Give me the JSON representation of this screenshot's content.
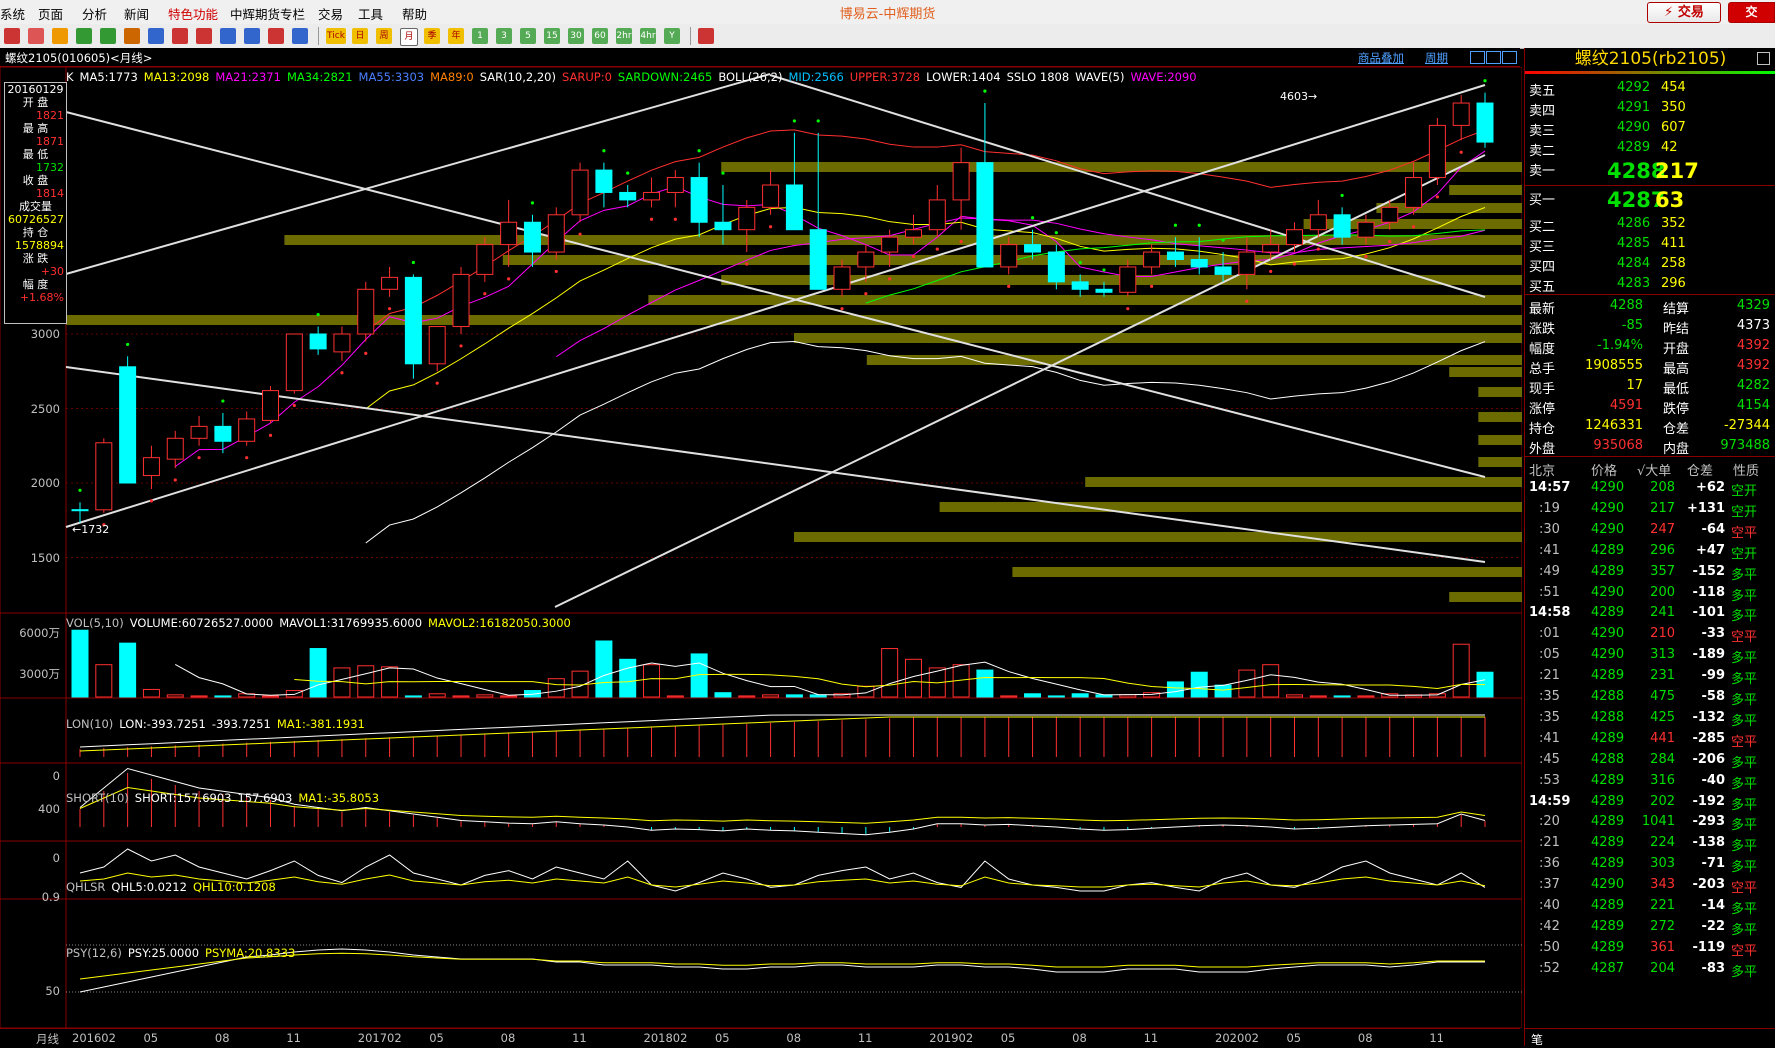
{
  "menu": {
    "items": [
      "系统",
      "页面",
      "分析",
      "新闻",
      "特色功能",
      "中辉期货专栏",
      "交易",
      "工具",
      "帮助"
    ],
    "app_title": "博易云-中辉期货",
    "trade_button": "⚡ 交易"
  },
  "toolbar": {
    "periods": [
      "1",
      "3",
      "5",
      "15",
      "30",
      "60",
      "2hr",
      "4hr",
      "Y"
    ],
    "labels": [
      "Tick",
      "日",
      "周",
      "月",
      "季",
      "年"
    ]
  },
  "chart_header": {
    "title": "螺纹2105(010605)<月线>",
    "overlay_link": "商品叠加",
    "period_link": "周期"
  },
  "indicators": {
    "k_line": [
      {
        "text": "K",
        "color": "#ffffff"
      },
      {
        "text": "MA5:1773",
        "color": "#ffffff"
      },
      {
        "text": "MA13:2098",
        "color": "#ffff00"
      },
      {
        "text": "MA21:2371",
        "color": "#ff00ff"
      },
      {
        "text": "MA34:2821",
        "color": "#00ff00"
      },
      {
        "text": "MA55:3303",
        "color": "#4a7fff"
      },
      {
        "text": "MA89:0",
        "color": "#ff8000"
      },
      {
        "text": "SAR(10,2,20)",
        "color": "#ffffff"
      },
      {
        "text": "SARUP:0",
        "color": "#ff3030"
      },
      {
        "text": "SARDOWN:2465",
        "color": "#00ff00"
      },
      {
        "text": "BOLL(26,2)",
        "color": "#ffffff"
      },
      {
        "text": "MID:2566",
        "color": "#00c0ff"
      },
      {
        "text": "UPPER:3728",
        "color": "#ff3030"
      },
      {
        "text": "LOWER:1404",
        "color": "#ffffff"
      },
      {
        "text": "SSLO 1808",
        "color": "#ffffff"
      },
      {
        "text": "WAVE(5)",
        "color": "#ffffff"
      },
      {
        "text": "WAVE:2090",
        "color": "#ff00ff"
      }
    ],
    "vol": [
      {
        "text": "VOL(5,10)",
        "color": "#c0c0c0"
      },
      {
        "text": "VOLUME:60726527.0000",
        "color": "#ffffff"
      },
      {
        "text": "MAVOL1:31769935.6000",
        "color": "#ffffff"
      },
      {
        "text": "MAVOL2:16182050.3000",
        "color": "#ffff00"
      }
    ],
    "lon": [
      {
        "text": "LON(10)",
        "color": "#c0c0c0"
      },
      {
        "text": "LON:-393.7251",
        "color": "#ffffff"
      },
      {
        "text": "-393.7251",
        "color": "#ffffff"
      },
      {
        "text": "MA1:-381.1931",
        "color": "#ffff00"
      }
    ],
    "short": [
      {
        "text": "SHORT(10)",
        "color": "#c0c0c0"
      },
      {
        "text": "SHORT:157.6903",
        "color": "#ffffff"
      },
      {
        "text": "157.6903",
        "color": "#ffffff"
      },
      {
        "text": "MA1:-35.8053",
        "color": "#ffff00"
      }
    ],
    "qhlsr": [
      {
        "text": "QHLSR",
        "color": "#c0c0c0"
      },
      {
        "text": "QHL5:0.0212",
        "color": "#ffffff"
      },
      {
        "text": "QHL10:0.1208",
        "color": "#ffff00"
      }
    ],
    "psy": [
      {
        "text": "PSY(12,6)",
        "color": "#c0c0c0"
      },
      {
        "text": "PSY:25.0000",
        "color": "#ffffff"
      },
      {
        "text": "PSYMA:20.8333",
        "color": "#ffff00"
      }
    ]
  },
  "axes": {
    "price_ticks": [
      "3000",
      "2500",
      "2000",
      "1500"
    ],
    "vol_ticks": [
      "6000万",
      "3000万"
    ],
    "lon_ticks": [
      "0"
    ],
    "short_ticks": [
      "400",
      "0"
    ],
    "qhlsr_ticks": [
      "0.9"
    ],
    "psy_ticks": [
      "50"
    ],
    "time_label": "月线",
    "time_ticks": [
      "201602",
      "05",
      "08",
      "11",
      "201702",
      "05",
      "08",
      "11",
      "201802",
      "05",
      "08",
      "11",
      "201902",
      "05",
      "08",
      "11",
      "202002",
      "05",
      "08",
      "11"
    ]
  },
  "annotations": {
    "high": "4603",
    "low": "1732"
  },
  "info_box": [
    {
      "label": "20160129",
      "value": ""
    },
    {
      "label": "开 盘",
      "value": "1821"
    },
    {
      "label": "最 高",
      "value": "1871"
    },
    {
      "label": "最 低",
      "value": "1732"
    },
    {
      "label": "收 盘",
      "value": "1814"
    },
    {
      "label": "成交量",
      "value": "60726527"
    },
    {
      "label": "持 仓",
      "value": "1578894"
    },
    {
      "label": "涨 跌",
      "value": "+30"
    },
    {
      "label": "幅 度",
      "value": "+1.68%"
    }
  ],
  "quote": {
    "title": "螺纹2105(rb2105)",
    "asks": [
      {
        "label": "卖五",
        "price": "4292",
        "vol": "454"
      },
      {
        "label": "卖四",
        "price": "4291",
        "vol": "350"
      },
      {
        "label": "卖三",
        "price": "4290",
        "vol": "607"
      },
      {
        "label": "卖二",
        "price": "4289",
        "vol": "42"
      },
      {
        "label": "卖一",
        "price": "4288",
        "vol": "217"
      }
    ],
    "bids": [
      {
        "label": "买一",
        "price": "4287",
        "vol": "63"
      },
      {
        "label": "买二",
        "price": "4286",
        "vol": "352"
      },
      {
        "label": "买三",
        "price": "4285",
        "vol": "411"
      },
      {
        "label": "买四",
        "price": "4284",
        "vol": "258"
      },
      {
        "label": "买五",
        "price": "4283",
        "vol": "296"
      }
    ],
    "stats": [
      {
        "l1": "最新",
        "v1": "4288",
        "c1": "#00e000",
        "l2": "结算",
        "v2": "4329",
        "c2": "#00e000"
      },
      {
        "l1": "涨跌",
        "v1": "-85",
        "c1": "#00e000",
        "l2": "昨结",
        "v2": "4373",
        "c2": "#ffffff"
      },
      {
        "l1": "幅度",
        "v1": "-1.94%",
        "c1": "#00e000",
        "l2": "开盘",
        "v2": "4392",
        "c2": "#ff3030"
      },
      {
        "l1": "总手",
        "v1": "1908555",
        "c1": "#ffff00",
        "l2": "最高",
        "v2": "4392",
        "c2": "#ff3030"
      },
      {
        "l1": "现手",
        "v1": "17",
        "c1": "#ffff00",
        "l2": "最低",
        "v2": "4282",
        "c2": "#00e000"
      },
      {
        "l1": "涨停",
        "v1": "4591",
        "c1": "#ff3030",
        "l2": "跌停",
        "v2": "4154",
        "c2": "#00e000"
      },
      {
        "l1": "持仓",
        "v1": "1246331",
        "c1": "#ffff00",
        "l2": "仓差",
        "v2": "-27344",
        "c2": "#ffff00"
      },
      {
        "l1": "外盘",
        "v1": "935068",
        "c1": "#ff3030",
        "l2": "内盘",
        "v2": "973488",
        "c2": "#00e000"
      }
    ],
    "tick_header": [
      "北京",
      "价格",
      "√大单",
      "仓差",
      "性质"
    ],
    "ticks": [
      {
        "t": "14:57",
        "p": "4290",
        "v": "208",
        "vc": "#00e000",
        "d": "+62",
        "n": "空开",
        "nc": "#00e000"
      },
      {
        "t": ":19",
        "p": "4290",
        "v": "217",
        "vc": "#00e000",
        "d": "+131",
        "n": "空开",
        "nc": "#00e000"
      },
      {
        "t": ":30",
        "p": "4290",
        "v": "247",
        "vc": "#ff3030",
        "d": "-64",
        "n": "空平",
        "nc": "#ff3030"
      },
      {
        "t": ":41",
        "p": "4289",
        "v": "296",
        "vc": "#00e000",
        "d": "+47",
        "n": "空开",
        "nc": "#00e000"
      },
      {
        "t": ":49",
        "p": "4289",
        "v": "357",
        "vc": "#00e000",
        "d": "-152",
        "n": "多平",
        "nc": "#00e000"
      },
      {
        "t": ":51",
        "p": "4290",
        "v": "200",
        "vc": "#00e000",
        "d": "-118",
        "n": "多平",
        "nc": "#00e000"
      },
      {
        "t": "14:58",
        "p": "4289",
        "v": "241",
        "vc": "#00e000",
        "d": "-101",
        "n": "多平",
        "nc": "#00e000"
      },
      {
        "t": ":01",
        "p": "4290",
        "v": "210",
        "vc": "#ff3030",
        "d": "-33",
        "n": "空平",
        "nc": "#ff3030"
      },
      {
        "t": ":05",
        "p": "4290",
        "v": "313",
        "vc": "#00e000",
        "d": "-189",
        "n": "多平",
        "nc": "#00e000"
      },
      {
        "t": ":21",
        "p": "4289",
        "v": "231",
        "vc": "#00e000",
        "d": "-99",
        "n": "多平",
        "nc": "#00e000"
      },
      {
        "t": ":35",
        "p": "4288",
        "v": "475",
        "vc": "#00e000",
        "d": "-58",
        "n": "多平",
        "nc": "#00e000"
      },
      {
        "t": ":35",
        "p": "4288",
        "v": "425",
        "vc": "#00e000",
        "d": "-132",
        "n": "多平",
        "nc": "#00e000"
      },
      {
        "t": ":41",
        "p": "4289",
        "v": "441",
        "vc": "#ff3030",
        "d": "-285",
        "n": "空平",
        "nc": "#ff3030"
      },
      {
        "t": ":45",
        "p": "4288",
        "v": "284",
        "vc": "#00e000",
        "d": "-206",
        "n": "多平",
        "nc": "#00e000"
      },
      {
        "t": ":53",
        "p": "4289",
        "v": "316",
        "vc": "#00e000",
        "d": "-40",
        "n": "多平",
        "nc": "#00e000"
      },
      {
        "t": "14:59",
        "p": "4289",
        "v": "202",
        "vc": "#00e000",
        "d": "-192",
        "n": "多平",
        "nc": "#00e000"
      },
      {
        "t": ":20",
        "p": "4289",
        "v": "1041",
        "vc": "#00e000",
        "d": "-293",
        "n": "多平",
        "nc": "#00e000"
      },
      {
        "t": ":21",
        "p": "4289",
        "v": "224",
        "vc": "#00e000",
        "d": "-138",
        "n": "多平",
        "nc": "#00e000"
      },
      {
        "t": ":36",
        "p": "4289",
        "v": "303",
        "vc": "#00e000",
        "d": "-71",
        "n": "多平",
        "nc": "#00e000"
      },
      {
        "t": ":37",
        "p": "4290",
        "v": "343",
        "vc": "#ff3030",
        "d": "-203",
        "n": "空平",
        "nc": "#ff3030"
      },
      {
        "t": ":40",
        "p": "4289",
        "v": "221",
        "vc": "#00e000",
        "d": "-14",
        "n": "多平",
        "nc": "#00e000"
      },
      {
        "t": ":42",
        "p": "4289",
        "v": "272",
        "vc": "#00e000",
        "d": "-22",
        "n": "多平",
        "nc": "#00e000"
      },
      {
        "t": ":50",
        "p": "4289",
        "v": "361",
        "vc": "#ff3030",
        "d": "-119",
        "n": "空平",
        "nc": "#ff3030"
      },
      {
        "t": ":52",
        "p": "4287",
        "v": "204",
        "vc": "#00e000",
        "d": "-83",
        "n": "多平",
        "nc": "#00e000"
      }
    ],
    "footer_tab": "笔"
  },
  "chart_data": {
    "type": "candlestick",
    "period": "monthly",
    "x": [
      "201602",
      "201603",
      "201604",
      "201605",
      "201606",
      "201607",
      "201608",
      "201609",
      "201610",
      "201611",
      "201612",
      "201701",
      "201702",
      "201703",
      "201704",
      "201705",
      "201706",
      "201707",
      "201708",
      "201709",
      "201710",
      "201711",
      "201712",
      "201801",
      "201802",
      "201803",
      "201804",
      "201805",
      "201806",
      "201807",
      "201808",
      "201809",
      "201810",
      "201811",
      "201812",
      "201901",
      "201902",
      "201903",
      "201904",
      "201905",
      "201906",
      "201907",
      "201908",
      "201909",
      "201910",
      "201911",
      "201912",
      "202001",
      "202002",
      "202003",
      "202004",
      "202005",
      "202006",
      "202007",
      "202008",
      "202009",
      "202010",
      "202011",
      "202012",
      "202101"
    ],
    "ohlc": [
      [
        1821,
        1871,
        1732,
        1814
      ],
      [
        1820,
        2300,
        1800,
        2270
      ],
      [
        2780,
        2850,
        2050,
        2000
      ],
      [
        2050,
        2250,
        1960,
        2170
      ],
      [
        2160,
        2350,
        2100,
        2300
      ],
      [
        2300,
        2450,
        2250,
        2380
      ],
      [
        2380,
        2470,
        2200,
        2280
      ],
      [
        2280,
        2480,
        2250,
        2430
      ],
      [
        2420,
        2650,
        2400,
        2620
      ],
      [
        2620,
        3000,
        2600,
        3000
      ],
      [
        3000,
        3050,
        2860,
        2900
      ],
      [
        2880,
        3050,
        2820,
        3000
      ],
      [
        3000,
        3350,
        2950,
        3300
      ],
      [
        3300,
        3450,
        3250,
        3380
      ],
      [
        3380,
        3400,
        2700,
        2800
      ],
      [
        2800,
        2950,
        2750,
        3050
      ],
      [
        3050,
        3450,
        3000,
        3400
      ],
      [
        3400,
        3650,
        3350,
        3600
      ],
      [
        3600,
        3900,
        3450,
        3750
      ],
      [
        3750,
        3800,
        3450,
        3550
      ],
      [
        3550,
        3850,
        3500,
        3800
      ],
      [
        3800,
        4150,
        3750,
        4100
      ],
      [
        4100,
        4150,
        3850,
        3950
      ],
      [
        3950,
        4000,
        3850,
        3900
      ],
      [
        3900,
        4050,
        3850,
        3950
      ],
      [
        3950,
        4100,
        3850,
        4050
      ],
      [
        4050,
        4150,
        3650,
        3750
      ],
      [
        3750,
        4000,
        3600,
        3700
      ],
      [
        3700,
        3900,
        3550,
        3850
      ],
      [
        3850,
        4100,
        3800,
        4000
      ],
      [
        4000,
        4350,
        3900,
        3700
      ],
      [
        3700,
        4350,
        3600,
        3300
      ],
      [
        3300,
        3500,
        3250,
        3450
      ],
      [
        3450,
        3600,
        3350,
        3550
      ],
      [
        3550,
        3700,
        3450,
        3650
      ],
      [
        3650,
        3800,
        3600,
        3700
      ],
      [
        3700,
        4000,
        3650,
        3900
      ],
      [
        3900,
        4250,
        3700,
        4150
      ],
      [
        4150,
        4550,
        3450,
        3450
      ],
      [
        3450,
        3650,
        3400,
        3600
      ],
      [
        3600,
        3700,
        3500,
        3550
      ],
      [
        3550,
        3600,
        3300,
        3350
      ],
      [
        3350,
        3400,
        3250,
        3300
      ],
      [
        3300,
        3350,
        3250,
        3280
      ],
      [
        3280,
        3500,
        3250,
        3450
      ],
      [
        3450,
        3600,
        3400,
        3550
      ],
      [
        3550,
        3650,
        3450,
        3500
      ],
      [
        3500,
        3650,
        3400,
        3450
      ],
      [
        3450,
        3550,
        3350,
        3400
      ],
      [
        3400,
        3650,
        3300,
        3550
      ],
      [
        3550,
        3700,
        3500,
        3600
      ],
      [
        3600,
        3750,
        3550,
        3700
      ],
      [
        3700,
        3900,
        3650,
        3800
      ],
      [
        3800,
        3850,
        3600,
        3650
      ],
      [
        3650,
        3800,
        3600,
        3750
      ],
      [
        3750,
        3900,
        3700,
        3850
      ],
      [
        3850,
        4150,
        3800,
        4050
      ],
      [
        4050,
        4450,
        4000,
        4400
      ],
      [
        4400,
        4603,
        4300,
        4550
      ],
      [
        4550,
        4620,
        4250,
        4288
      ]
    ],
    "volume_wan": [
      6200,
      3000,
      5000,
      700,
      200,
      100,
      100,
      300,
      100,
      600,
      4500,
      2700,
      2900,
      2800,
      100,
      300,
      100,
      200,
      100,
      600,
      1700,
      2400,
      5200,
      3500,
      3000,
      100,
      4000,
      400,
      100,
      200,
      200,
      200,
      300,
      1000,
      4500,
      3500,
      2700,
      3000,
      2500,
      100,
      300,
      100,
      300,
      200,
      200,
      400,
      1400,
      2300,
      1100,
      2500,
      3000,
      200,
      100,
      100,
      100,
      300,
      200,
      300,
      4900,
      2300
    ],
    "ylim": [
      1300,
      4700
    ]
  }
}
